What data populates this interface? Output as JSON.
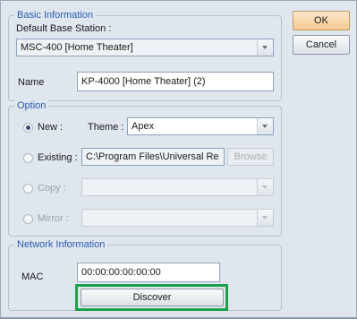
{
  "basic": {
    "legend": "Basic Information",
    "base_station_label": "Default Base Station :",
    "base_station_value": "MSC-400 [Home Theater]",
    "name_label": "Name",
    "name_value": "KP-4000 [Home Theater] (2)"
  },
  "buttons": {
    "ok": "OK",
    "cancel": "Cancel",
    "browse": "Browse",
    "discover": "Discover"
  },
  "option": {
    "legend": "Option",
    "new_label": "New :",
    "theme_label": "Theme :",
    "theme_value": "Apex",
    "existing_label": "Existing :",
    "existing_path": "C:\\Program Files\\Universal Re",
    "copy_label": "Copy :",
    "mirror_label": "Mirror :",
    "selected": "New"
  },
  "network": {
    "legend": "Network Information",
    "mac_label": "MAC",
    "mac_value": "00:00:00:00:00:00"
  },
  "colors": {
    "highlight": "#16a34a",
    "legend_text": "#2b5bb5",
    "ok_button": "#f4c890"
  }
}
